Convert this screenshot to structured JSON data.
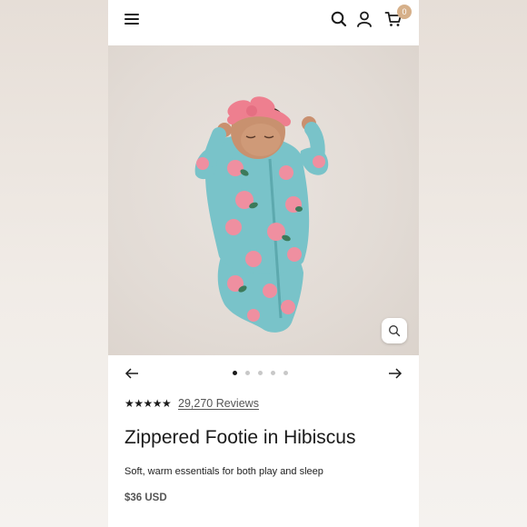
{
  "header": {
    "menu_icon": "hamburger-menu-icon",
    "search_icon": "search-icon",
    "account_icon": "account-icon",
    "cart_icon": "cart-icon",
    "cart_count": "0",
    "badge_color": "#d6b08a"
  },
  "gallery": {
    "image_subject": "baby in teal hibiscus zippered footie with pink headband",
    "zoom_icon": "zoom-icon",
    "prev_icon": "arrow-left-icon",
    "next_icon": "arrow-right-icon",
    "slide_count": 5,
    "active_slide": 1
  },
  "product": {
    "rating": 5,
    "stars_text": "★★★★★",
    "reviews_text": "29,270 Reviews",
    "title": "Zippered Footie in Hibiscus",
    "subtitle": "Soft, warm essentials for both play and sleep",
    "price": "$36 USD"
  },
  "colors": {
    "footie": "#76c2c8",
    "flower": "#ef8fa0",
    "headband": "#ee7f8f",
    "text": "#1a1a1a"
  }
}
